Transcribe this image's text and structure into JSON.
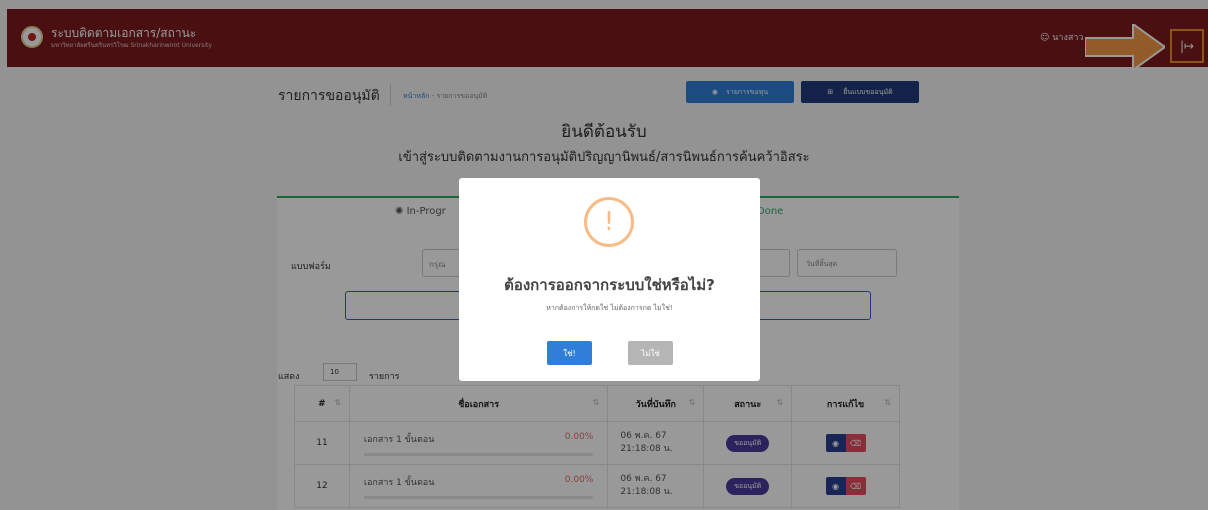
{
  "header": {
    "title": "ระบบติดตามเอกสาร/สถานะ",
    "subtitle": "มหาวิทยาลัยศรีนครินทรวิโรฒ Srinakharinwirot University",
    "user": "นางสาว"
  },
  "page": {
    "title": "รายการขออนุมัติ",
    "breadcrumb_home": "หน้าหลัก",
    "breadcrumb_sep": "-",
    "breadcrumb_current": "รายการขออนุมัติ",
    "btn_list": "รายการขอทุน",
    "btn_new": "ยื่นแบบขออนุมัติ"
  },
  "welcome": {
    "title": "ยินดีต้อนรับ",
    "subtitle": "เข้าสู่ระบบติดตามงานการอนุมัติปริญญานิพนธ์/สารนิพนธ์การค้นคว้าอิสระ"
  },
  "tabs": [
    {
      "label": "In-Progr"
    },
    {
      "label": "Done"
    }
  ],
  "filters": {
    "form_label": "แบบฟอร์ม",
    "form_placeholder": "กรุณ",
    "end_date_placeholder": "วันที่สิ้นสุด"
  },
  "list": {
    "show_label": "แสดง",
    "page_size": "10",
    "unit": "รายการ"
  },
  "table": {
    "columns": [
      "#",
      "ชื่อเอกสาร",
      "วันที่บันทึก",
      "สถานะ",
      "การแก้ไข"
    ],
    "rows": [
      {
        "no": "11",
        "name": "เอกสาร 1 ขั้นตอน",
        "percent": "0.00%",
        "date": "06 พ.ค. 67",
        "time": "21:18:08 น.",
        "status": "ขออนุมัติ"
      },
      {
        "no": "12",
        "name": "เอกสาร 1 ขั้นตอน",
        "percent": "0.00%",
        "date": "06 พ.ค. 67",
        "time": "21:18:08 น.",
        "status": "ขออนุมัติ"
      }
    ]
  },
  "modal": {
    "icon": "!",
    "title": "ต้องการออกจากระบบใช่หรือไม่?",
    "text": "หากต้องการให้กดใช่ ไม่ต้องการกด ไม่ใช่!",
    "confirm": "ใช่!",
    "cancel": "ไม่ใช่"
  },
  "colors": {
    "header_bg": "#7b1a1d",
    "accent_blue": "#2f7ed8",
    "success_green": "#2ea865",
    "warning_orange": "#f8bb86",
    "highlight_orange": "#f08a2a"
  }
}
